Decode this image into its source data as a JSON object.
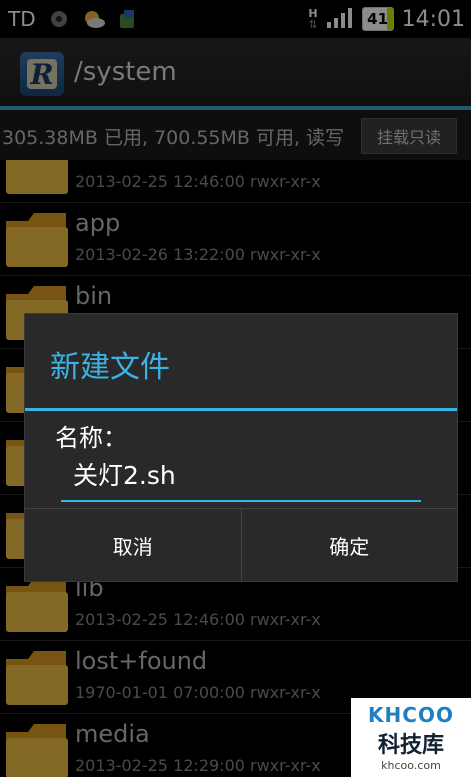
{
  "status_bar": {
    "carrier": "TD",
    "network_type": "H",
    "battery_level": "41",
    "time": "14:01",
    "icons": [
      "circle-icon",
      "weather-icon",
      "android-icon",
      "data-arrows-icon",
      "signal-icon",
      "battery-icon"
    ]
  },
  "action_bar": {
    "app_icon": "app-logo-icon",
    "title": "/system"
  },
  "info_bar": {
    "storage_text": "305.38MB 已用, 700.55MB 可用, 读写",
    "mount_button": "挂载只读"
  },
  "files": [
    {
      "name": "",
      "meta": "2013-02-25 12:46:00  rwxr-xr-x"
    },
    {
      "name": "app",
      "meta": "2013-02-26 13:22:00  rwxr-xr-x"
    },
    {
      "name": "bin",
      "meta": ""
    },
    {
      "name": "",
      "meta": ""
    },
    {
      "name": "",
      "meta": ""
    },
    {
      "name": "",
      "meta": ""
    },
    {
      "name": "lib",
      "meta": "2013-02-25 12:46:00  rwxr-xr-x"
    },
    {
      "name": "lost+found",
      "meta": "1970-01-01 07:00:00  rwxr-xr-x"
    },
    {
      "name": "media",
      "meta": "2013-02-25 12:29:00  rwxr-xr-x"
    }
  ],
  "dialog": {
    "title": "新建文件",
    "label": "名称：",
    "input_value": "关灯2.sh",
    "cancel": "取消",
    "confirm": "确定"
  },
  "watermark": {
    "brand": "KHCOO",
    "name": "科技库",
    "site": "khcoo.com"
  },
  "colors": {
    "accent": "#3ab4e6",
    "folder": "#e8b23a"
  }
}
